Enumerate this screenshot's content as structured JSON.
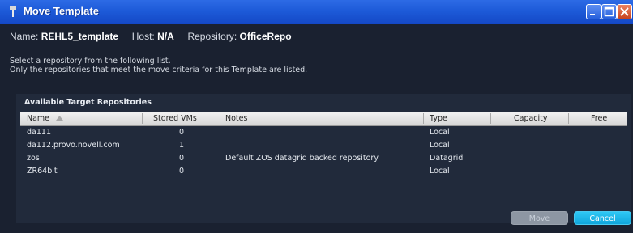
{
  "window": {
    "title": "Move Template"
  },
  "info": {
    "name_label": "Name:",
    "name_value": "REHL5_template",
    "host_label": "Host:",
    "host_value": "N/A",
    "repo_label": "Repository:",
    "repo_value": "OfficeRepo"
  },
  "description": {
    "line1": "Select a repository from the following list.",
    "line2": "Only the repositories that meet the move criteria for this Template are listed."
  },
  "table": {
    "title": "Available Target Repositories",
    "columns": [
      "Name",
      "Stored VMs",
      "Notes",
      "Type",
      "Capacity",
      "Free"
    ],
    "rows": [
      {
        "name": "da111",
        "stored": "0",
        "notes": "",
        "type": "Local",
        "capacity": "",
        "free": ""
      },
      {
        "name": "da112.provo.novell.com",
        "stored": "1",
        "notes": "",
        "type": "Local",
        "capacity": "",
        "free": ""
      },
      {
        "name": "zos",
        "stored": "0",
        "notes": "Default ZOS datagrid backed repository",
        "type": "Datagrid",
        "capacity": "",
        "free": ""
      },
      {
        "name": "ZR64bit",
        "stored": "0",
        "notes": "",
        "type": "Local",
        "capacity": "",
        "free": ""
      }
    ]
  },
  "buttons": {
    "move": "Move",
    "cancel": "Cancel"
  },
  "colors": {
    "titlebar": "#1d5ad8",
    "background": "#1a2130",
    "accent": "#10a6dc"
  }
}
